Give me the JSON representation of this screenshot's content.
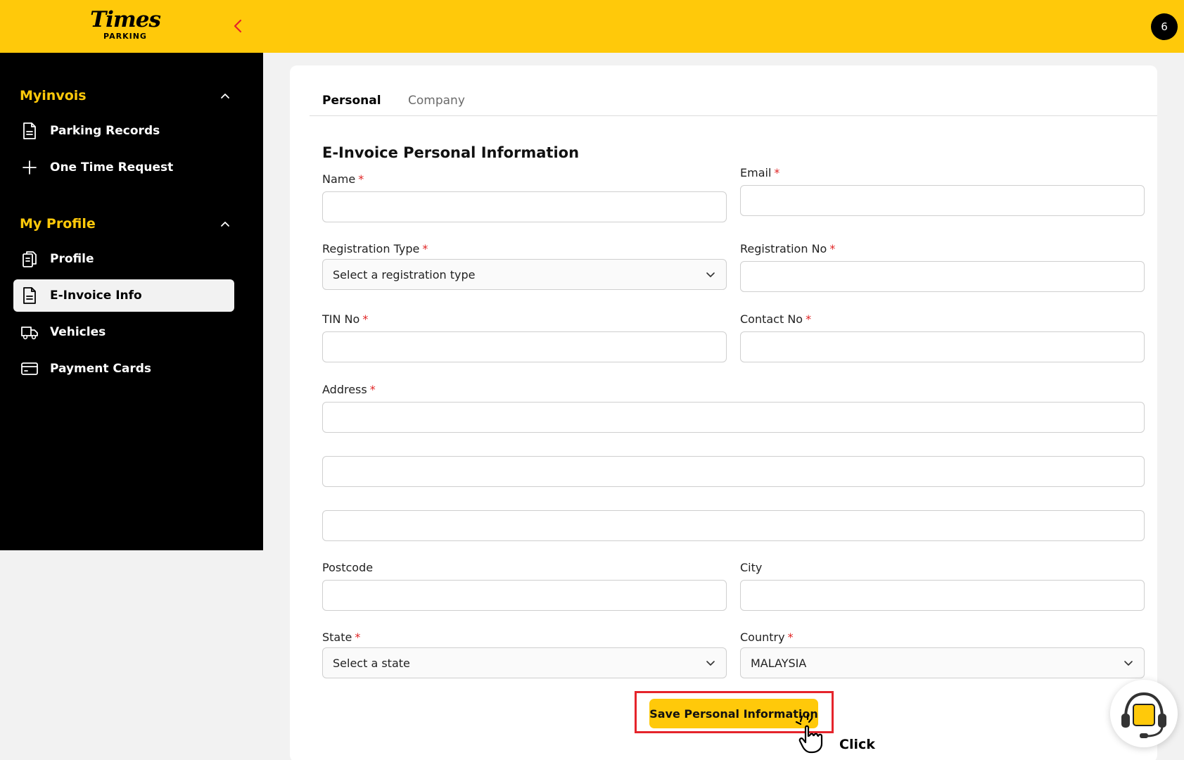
{
  "brand": {
    "logo_main": "Times",
    "logo_sub": "PARKING",
    "accent": "#ffc90a"
  },
  "header": {
    "avatar_text": "6"
  },
  "sidebar": {
    "sections": [
      {
        "title": "Myinvois",
        "items": [
          {
            "label": "Parking Records",
            "icon": "document-icon"
          },
          {
            "label": "One Time Request",
            "icon": "plus-icon"
          }
        ]
      },
      {
        "title": "My Profile",
        "items": [
          {
            "label": "Profile",
            "icon": "profile-doc-icon"
          },
          {
            "label": "E-Invoice Info",
            "icon": "document-icon",
            "active": true
          },
          {
            "label": "Vehicles",
            "icon": "truck-icon"
          },
          {
            "label": "Payment Cards",
            "icon": "card-icon"
          }
        ]
      }
    ]
  },
  "tabs": [
    {
      "label": "Personal",
      "active": true
    },
    {
      "label": "Company",
      "active": false
    }
  ],
  "form": {
    "title": "E-Invoice Personal Information",
    "required_mark": "*",
    "name_label": "Name",
    "email_label": "Email",
    "registration_type_label": "Registration Type",
    "registration_type_placeholder": "Select a registration type",
    "registration_no_label": "Registration No",
    "tin_label": "TIN No",
    "contact_label": "Contact No",
    "address_label": "Address",
    "postcode_label": "Postcode",
    "city_label": "City",
    "state_label": "State",
    "state_placeholder": "Select a state",
    "country_label": "Country",
    "country_value": "MALAYSIA",
    "save_label": "Save Personal Information"
  },
  "annotation": {
    "click_label": "Click",
    "highlight_color": "#e5242b"
  }
}
